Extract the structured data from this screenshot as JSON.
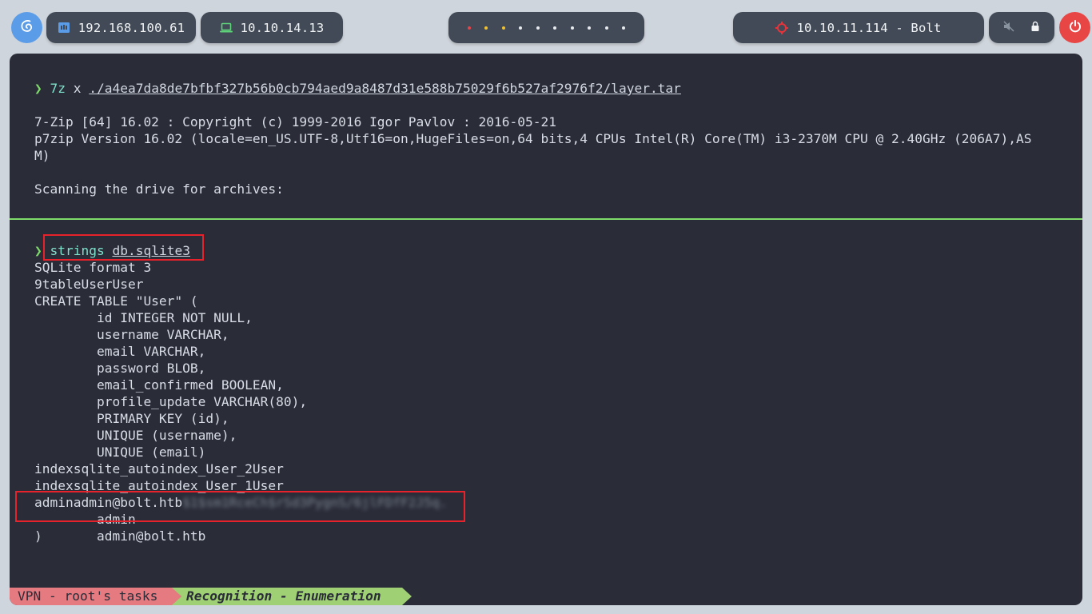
{
  "topbar": {
    "host_ip": "192.168.100.61",
    "vpn_ip": "10.10.14.13",
    "target": "10.10.11.114 - Bolt",
    "workspace_dots": 10,
    "colors": {
      "accent_blue": "#5b9ce8",
      "power_red": "#e84545",
      "pill_bg": "#414a56",
      "target_icon": "#e8333a"
    }
  },
  "terminal": {
    "block1": {
      "prompt_cmd": "7z",
      "prompt_arg_prefix": "x",
      "prompt_path": "./a4ea7da8de7bfbf327b56b0cb794aed9a8487d31e588b75029f6b527af2976f2/layer.tar",
      "output": [
        "7-Zip [64] 16.02 : Copyright (c) 1999-2016 Igor Pavlov : 2016-05-21",
        "p7zip Version 16.02 (locale=en_US.UTF-8,Utf16=on,HugeFiles=on,64 bits,4 CPUs Intel(R) Core(TM) i3-2370M CPU @ 2.40GHz (206A7),AS",
        "M)",
        "",
        "Scanning the drive for archives:"
      ]
    },
    "block2": {
      "prompt_cmd": "strings",
      "prompt_arg": "db.sqlite3",
      "output": [
        "SQLite format 3",
        "9tableUserUser",
        "CREATE TABLE \"User\" (",
        "        id INTEGER NOT NULL,",
        "        username VARCHAR,",
        "        email VARCHAR,",
        "        password BLOB,",
        "        email_confirmed BOOLEAN,",
        "        profile_update VARCHAR(80),",
        "        PRIMARY KEY (id),",
        "        UNIQUE (username),",
        "        UNIQUE (email)",
        "indexsqlite_autoindex_User_2User",
        "indexsqlite_autoindex_User_1User"
      ],
      "admin_line": "adminadmin@bolt.htb",
      "admin_hash_redacted": "$1$sm1RceCh$rSd3PygnS/6jlFDfF2J5q.",
      "after": [
        "        admin",
        ")       admin@bolt.htb"
      ]
    },
    "arrow_glyph": "❯"
  },
  "statusbar": {
    "left_label": "VPN - root's tasks",
    "right_label": "Recognition - Enumeration"
  }
}
